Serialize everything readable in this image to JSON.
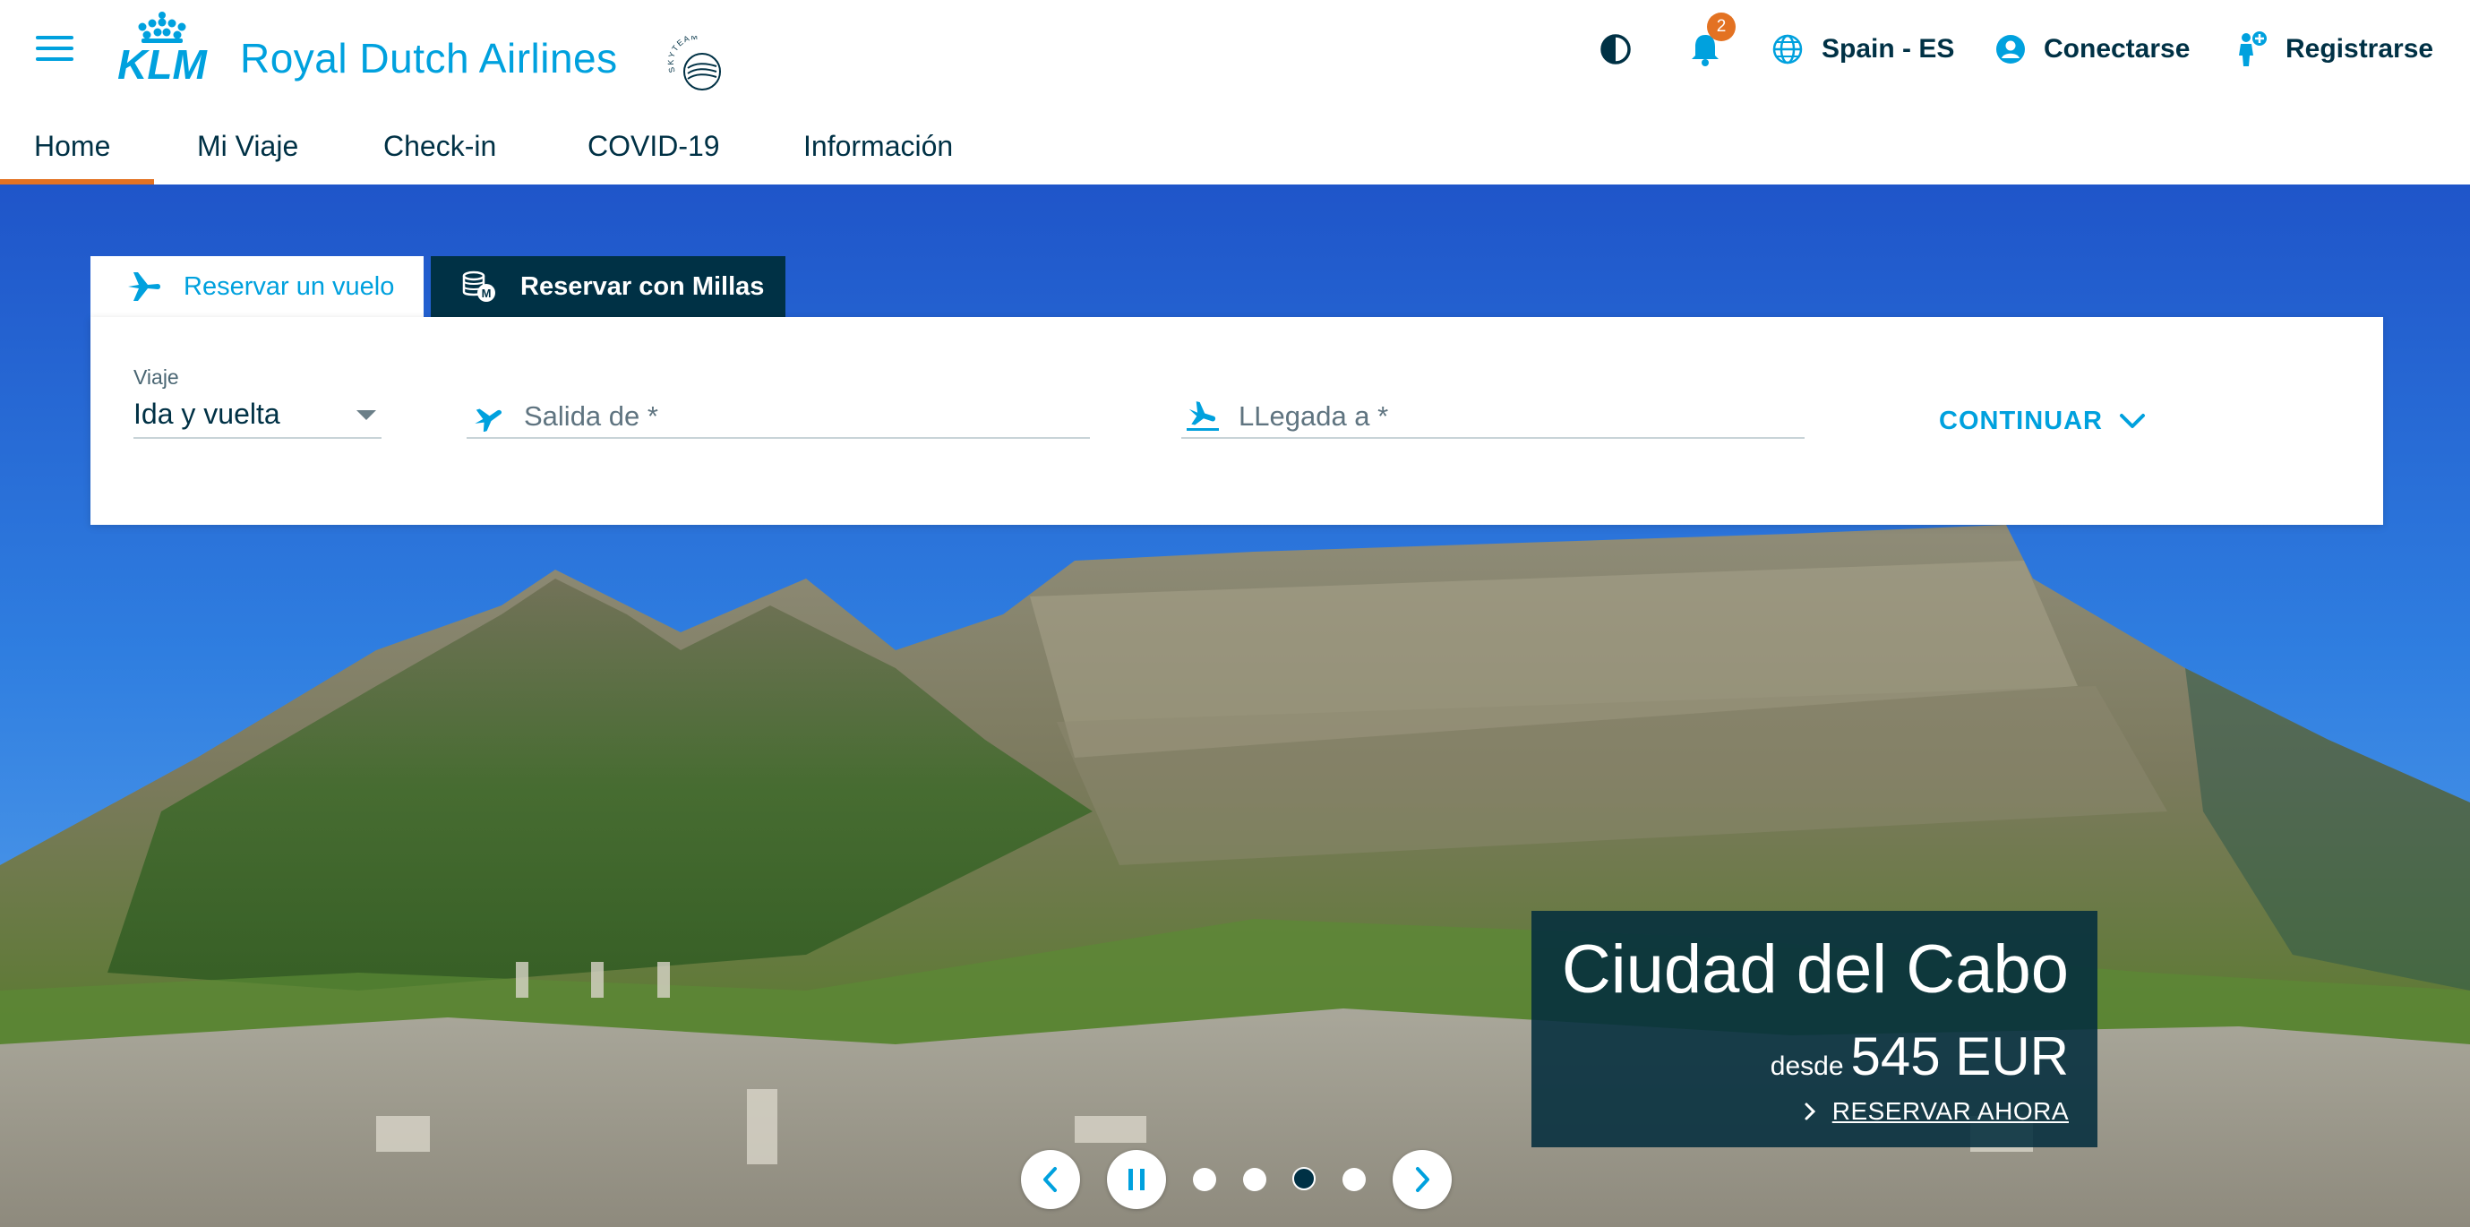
{
  "header": {
    "brand_name": "Royal Dutch Airlines",
    "logo_text": "KLM",
    "alliance_text": "SKYTEAM",
    "notifications_count": "2",
    "region_label": "Spain - ES",
    "login_label": "Conectarse",
    "register_label": "Registrarse"
  },
  "nav": {
    "items": [
      {
        "label": "Home",
        "active": true
      },
      {
        "label": "Mi Viaje"
      },
      {
        "label": "Check-in"
      },
      {
        "label": "COVID-19"
      },
      {
        "label": "Información"
      }
    ]
  },
  "booking": {
    "tabs": [
      {
        "label": "Reservar un vuelo",
        "active": true,
        "icon": "plane-icon"
      },
      {
        "label": "Reservar con Millas",
        "icon": "miles-coins-icon"
      }
    ],
    "trip_label": "Viaje",
    "trip_value": "Ida y vuelta",
    "departure_placeholder": "Salida de *",
    "arrival_placeholder": "LLegada a *",
    "continue_label": "CONTINUAR"
  },
  "promo": {
    "city": "Ciudad del Cabo",
    "from_label": "desde",
    "price": "545 EUR",
    "cta_label": "RESERVAR AHORA"
  },
  "carousel": {
    "slide_count": 4,
    "active_index": 2
  },
  "colors": {
    "klm_blue": "#00a1de",
    "navy": "#003145",
    "accent_orange": "#e37222"
  }
}
